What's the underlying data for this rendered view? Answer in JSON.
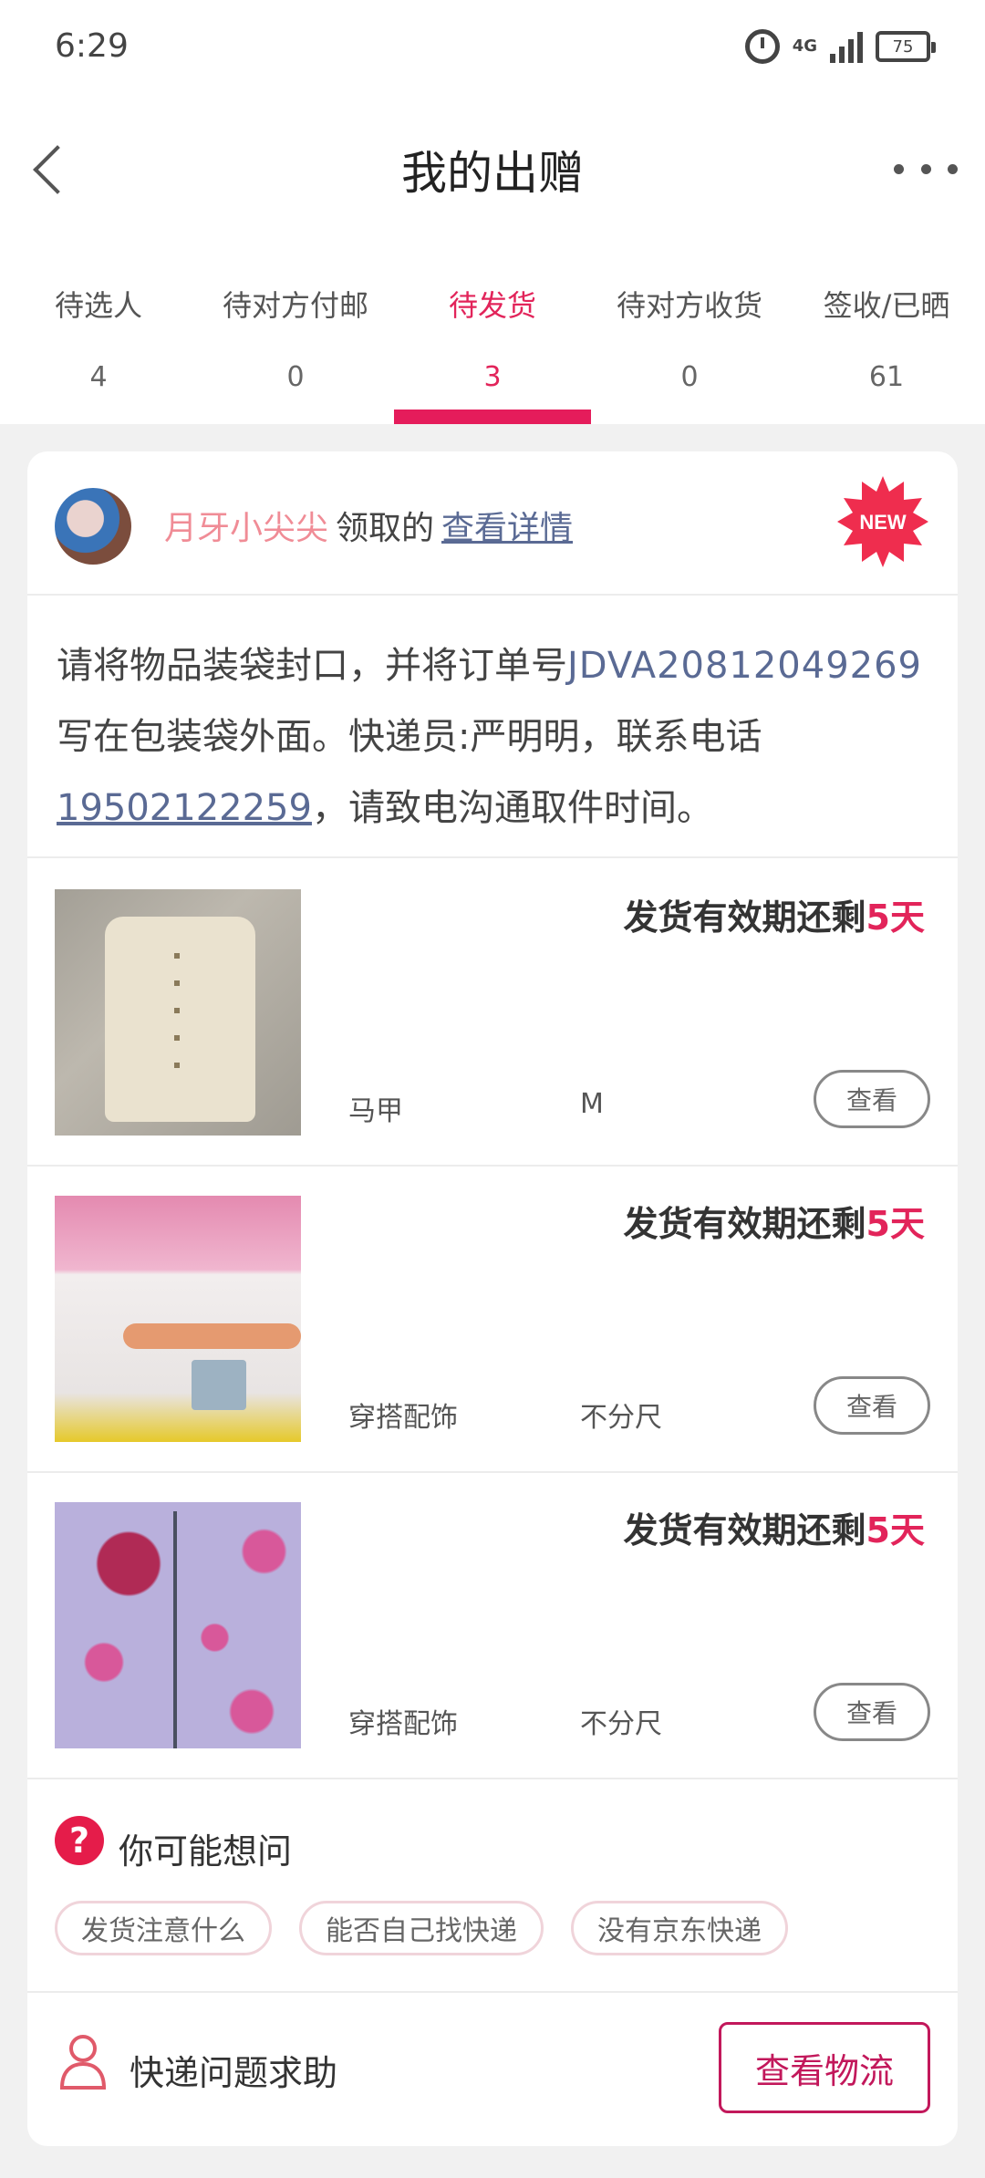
{
  "status_bar": {
    "time": "6:29",
    "network": "4G",
    "battery": "75",
    "icons": [
      "alarm-icon",
      "signal-icon",
      "battery-icon"
    ]
  },
  "navbar": {
    "title": "我的出赠",
    "back_icon": "back-arrow-icon",
    "more_icon": "more-icon"
  },
  "tabs": [
    {
      "label": "待选人",
      "count": "4",
      "active": false
    },
    {
      "label": "待对方付邮",
      "count": "0",
      "active": false
    },
    {
      "label": "待发货",
      "count": "3",
      "active": true
    },
    {
      "label": "待对方收货",
      "count": "0",
      "active": false
    },
    {
      "label": "签收/已晒",
      "count": "61",
      "active": false
    }
  ],
  "order": {
    "receiver_name": "月牙小尖尖",
    "receiver_suffix": "领取的",
    "detail_link": "查看详情",
    "badge": "NEW",
    "instruction": {
      "part1": "请将物品装袋封口，并将订单号",
      "order_id": "JDVA20812049269",
      "part2": "写在包装袋外面。快递员:严明明，联系电话",
      "phone": "19502122259",
      "part3": "，请致电沟通取件时间。"
    }
  },
  "items": [
    {
      "deadline_prefix": "发货有效期还剩",
      "days": "5天",
      "name": "马甲",
      "size": "M",
      "button": "查看"
    },
    {
      "deadline_prefix": "发货有效期还剩",
      "days": "5天",
      "name": "穿搭配饰",
      "size": "不分尺",
      "button": "查看"
    },
    {
      "deadline_prefix": "发货有效期还剩",
      "days": "5天",
      "name": "穿搭配饰",
      "size": "不分尺",
      "button": "查看"
    }
  ],
  "faq": {
    "title": "你可能想问",
    "icon_glyph": "?",
    "questions": [
      "发货注意什么",
      "能否自己找快递",
      "没有京东快递"
    ]
  },
  "help": {
    "text": "快递问题求助",
    "button": "查看物流"
  },
  "colors": {
    "accent": "#e51c5b",
    "link": "#5a6a94",
    "name": "#f08c96",
    "track_button": "#c2185b"
  }
}
